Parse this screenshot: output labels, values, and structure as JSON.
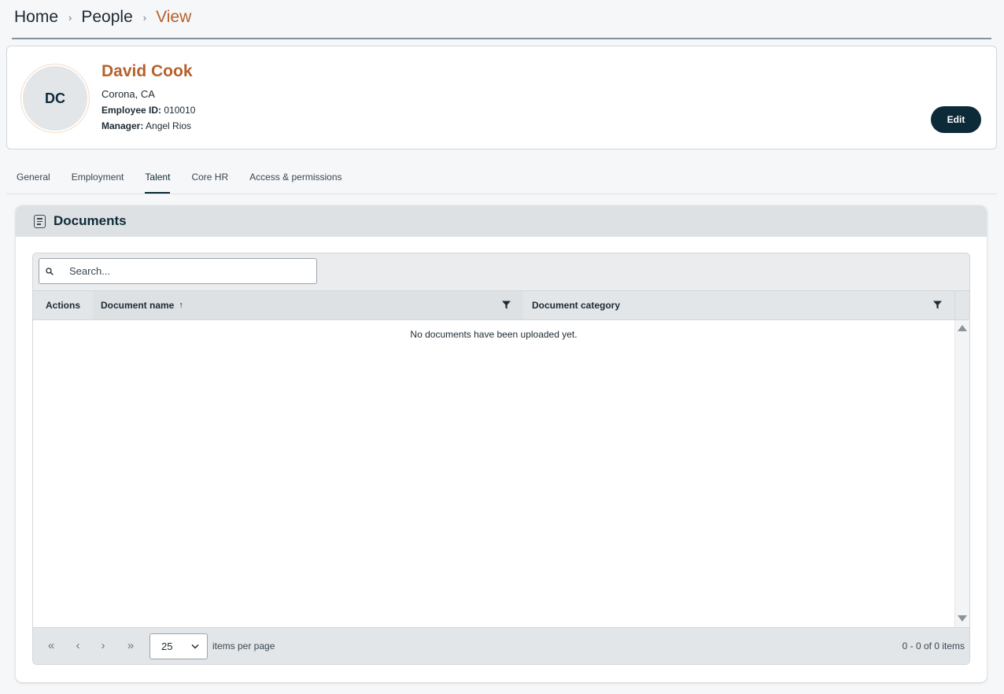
{
  "breadcrumb": {
    "home": "Home",
    "people": "People",
    "current": "View",
    "separator": "›"
  },
  "profile": {
    "initials": "DC",
    "name": "David Cook",
    "location": "Corona, CA",
    "employee_id_label": "Employee ID:",
    "employee_id": "010010",
    "manager_label": "Manager:",
    "manager": "Angel Rios",
    "edit_label": "Edit"
  },
  "tabs": [
    {
      "label": "General",
      "active": false
    },
    {
      "label": "Employment",
      "active": false
    },
    {
      "label": "Talent",
      "active": true
    },
    {
      "label": "Core HR",
      "active": false
    },
    {
      "label": "Access & permissions",
      "active": false
    }
  ],
  "documents": {
    "title": "Documents",
    "icon": "document-icon",
    "search": {
      "placeholder": "Search...",
      "value": ""
    },
    "columns": {
      "actions": "Actions",
      "name": "Document name",
      "name_sort": "ascending",
      "category": "Document category"
    },
    "empty_message": "No documents have been uploaded yet.",
    "pager": {
      "per_page": "25",
      "per_page_label": "items per page",
      "count": "0 - 0 of 0 items"
    }
  },
  "colors": {
    "accent": "#b5622c",
    "primary": "#0d2a38"
  }
}
